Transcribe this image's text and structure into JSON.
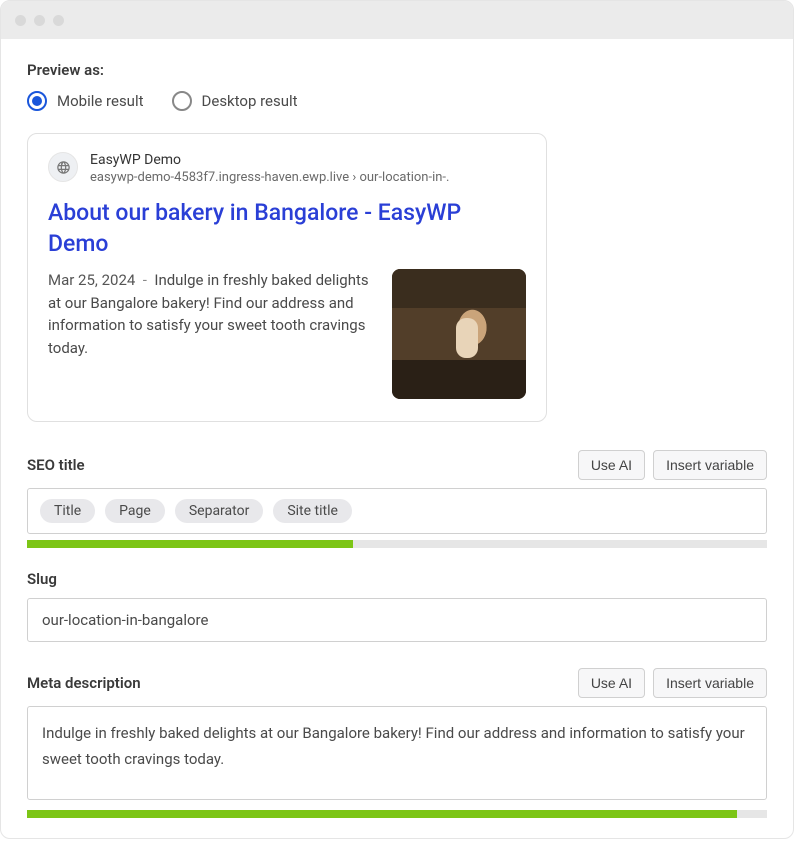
{
  "preview_as_label": "Preview as:",
  "radio_options": {
    "mobile": "Mobile result",
    "desktop": "Desktop result"
  },
  "preview": {
    "site_name": "EasyWP Demo",
    "url_display": "easywp-demo-4583f7.ingress-haven.ewp.live › our-location-in-.",
    "title": "About our bakery in Bangalore - EasyWP Demo",
    "date": "Mar 25, 2024",
    "description": "Indulge in freshly baked delights at our Bangalore bakery! Find our address and information to satisfy your sweet tooth cravings today."
  },
  "seo_title": {
    "label": "SEO title",
    "chips": [
      "Title",
      "Page",
      "Separator",
      "Site title"
    ],
    "progress_pct": 44
  },
  "slug": {
    "label": "Slug",
    "value": "our-location-in-bangalore"
  },
  "meta_description": {
    "label": "Meta description",
    "value": "Indulge in freshly baked delights at our Bangalore bakery! Find our address and information to satisfy your sweet tooth cravings today.",
    "progress_pct": 96
  },
  "buttons": {
    "use_ai": "Use AI",
    "insert_variable": "Insert variable"
  }
}
